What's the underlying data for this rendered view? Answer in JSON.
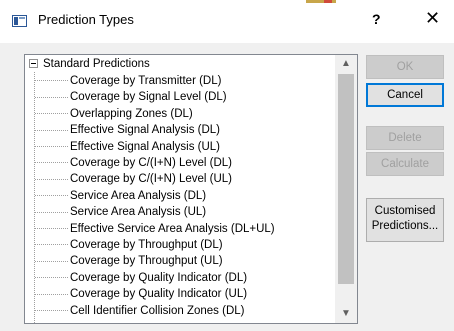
{
  "window": {
    "title": "Prediction Types",
    "help_label": "?",
    "close_label": "✕",
    "accent_color": "#0078d7"
  },
  "tree": {
    "root_label": "Standard Predictions",
    "items": [
      "Coverage by Transmitter (DL)",
      "Coverage by Signal Level (DL)",
      "Overlapping Zones (DL)",
      "Effective Signal Analysis (DL)",
      "Effective Signal Analysis (UL)",
      "Coverage by C/(I+N) Level (DL)",
      "Coverage by C/(I+N) Level (UL)",
      "Service Area Analysis (DL)",
      "Service Area Analysis (UL)",
      "Effective Service Area Analysis (DL+UL)",
      "Coverage by Throughput (DL)",
      "Coverage by Throughput (UL)",
      "Coverage by Quality Indicator (DL)",
      "Coverage by Quality Indicator (UL)",
      "Cell Identifier Collision Zones (DL)"
    ]
  },
  "buttons": {
    "ok": "OK",
    "cancel": "Cancel",
    "delete": "Delete",
    "calculate": "Calculate",
    "customised_line1": "Customised",
    "customised_line2": "Predictions..."
  }
}
